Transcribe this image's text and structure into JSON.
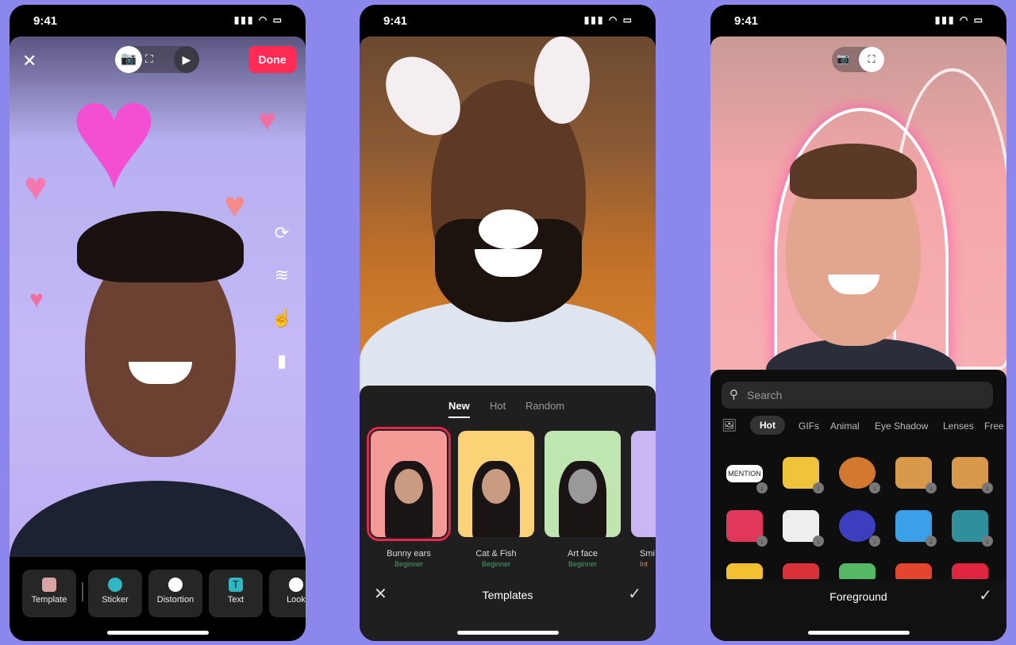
{
  "status_time": "9:41",
  "phone1": {
    "done_label": "Done",
    "toolbar": [
      {
        "label": "Template",
        "icon": "template-icon",
        "color": "#d9a4a4"
      },
      {
        "label": "Sticker",
        "icon": "sticker-icon",
        "color": "#2fb8c2"
      },
      {
        "label": "Distortion",
        "icon": "distortion-icon",
        "color": "#ffffff"
      },
      {
        "label": "Text",
        "icon": "text-icon",
        "color": "#2fb8c2"
      },
      {
        "label": "Look",
        "icon": "look-icon",
        "color": "#ffffff"
      }
    ],
    "text_icon_glyph": "T",
    "side_icons": [
      "flip-icon",
      "layers-icon",
      "touch-icon",
      "book-icon"
    ]
  },
  "phone2": {
    "tabs": [
      "New",
      "Hot",
      "Random"
    ],
    "active_tab": "New",
    "templates": [
      {
        "name": "Bunny ears",
        "level": "Beginner",
        "bg": "#f49a97",
        "selected": true
      },
      {
        "name": "Cat & Fish",
        "level": "Beginner",
        "bg": "#fbd276"
      },
      {
        "name": "Art face",
        "level": "Beginner",
        "bg": "#bfe6b0"
      },
      {
        "name": "Smi",
        "level": "Int",
        "bg": "#c9b6f3"
      }
    ],
    "title": "Templates"
  },
  "phone3": {
    "search_placeholder": "Search",
    "chips": [
      "Hot",
      "GIFs",
      "Animal",
      "Eye Shadow",
      "Lenses",
      "Free"
    ],
    "active_chip": "Hot",
    "mention_label": "MENTION",
    "stickers_colors": [
      "#ffffff",
      "#f0c43a",
      "#d2792f",
      "#d89a4a",
      "#d89a4a",
      "#e0375a",
      "#eeeeee",
      "#3b3fbf",
      "#3aa0e8",
      "#2f8f9a",
      "#f2c030",
      "#d9323a",
      "#55b865",
      "#e3452f",
      "#e0263f"
    ],
    "title": "Foreground"
  },
  "accent": "#fe2c55"
}
